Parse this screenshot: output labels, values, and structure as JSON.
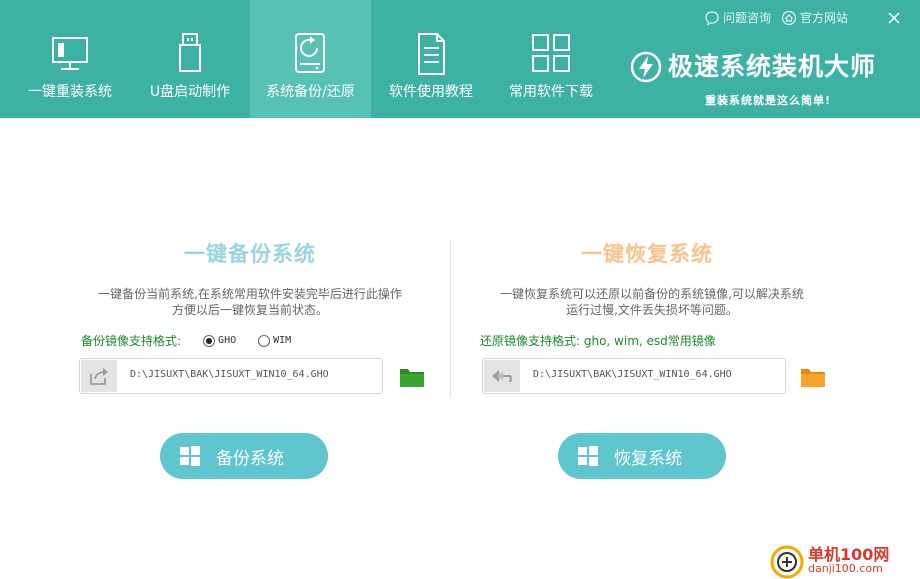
{
  "header": {
    "nav": [
      {
        "label": "一键重装系统",
        "icon": "monitor-icon"
      },
      {
        "label": "U盘启动制作",
        "icon": "usb-drive-icon"
      },
      {
        "label": "系统备份/还原",
        "icon": "hdd-restore-icon",
        "active": true
      },
      {
        "label": "软件使用教程",
        "icon": "document-icon"
      },
      {
        "label": "常用软件下载",
        "icon": "app-grid-icon"
      }
    ],
    "links": {
      "consult": "问题咨询",
      "website": "官方网站"
    },
    "brand_title": "极速系统装机大师",
    "brand_slogan": "重装系统就是这么简单!"
  },
  "backup": {
    "title": "一键备份系统",
    "desc_line1": "一键备份当前系统,在系统常用软件安装完毕后进行此操作",
    "desc_line2": "方便以后一键恢复当前状态。",
    "format_label": "备份镜像支持格式:",
    "format_options": [
      "GHO",
      "WIM"
    ],
    "format_selected": "GHO",
    "path": "D:\\JISUXT\\BAK\\JISUXT_WIN10_64.GHO",
    "button_label": "备份系统"
  },
  "restore": {
    "title": "一键恢复系统",
    "desc_line1": "一键恢复系统可以还原以前备份的系统镜像,可以解决系统",
    "desc_line2": "运行过慢,文件丢失损坏等问题。",
    "format_label": "还原镜像支持格式: gho, wim, esd常用镜像",
    "path": "D:\\JISUXT\\BAK\\JISUXT_WIN10_64.GHO",
    "button_label": "恢复系统"
  },
  "watermark": {
    "title": "单机100网",
    "url": "danji100.com"
  },
  "colors": {
    "header": "#3db2a4",
    "header_active": "#57c1b4",
    "button": "#5fc6d0",
    "backup_title": "#9bd3e3",
    "restore_title": "#f7c38e",
    "format_text": "#1c8a2c",
    "backup_folder": "#2a8a22",
    "restore_folder": "#f39a1e"
  }
}
